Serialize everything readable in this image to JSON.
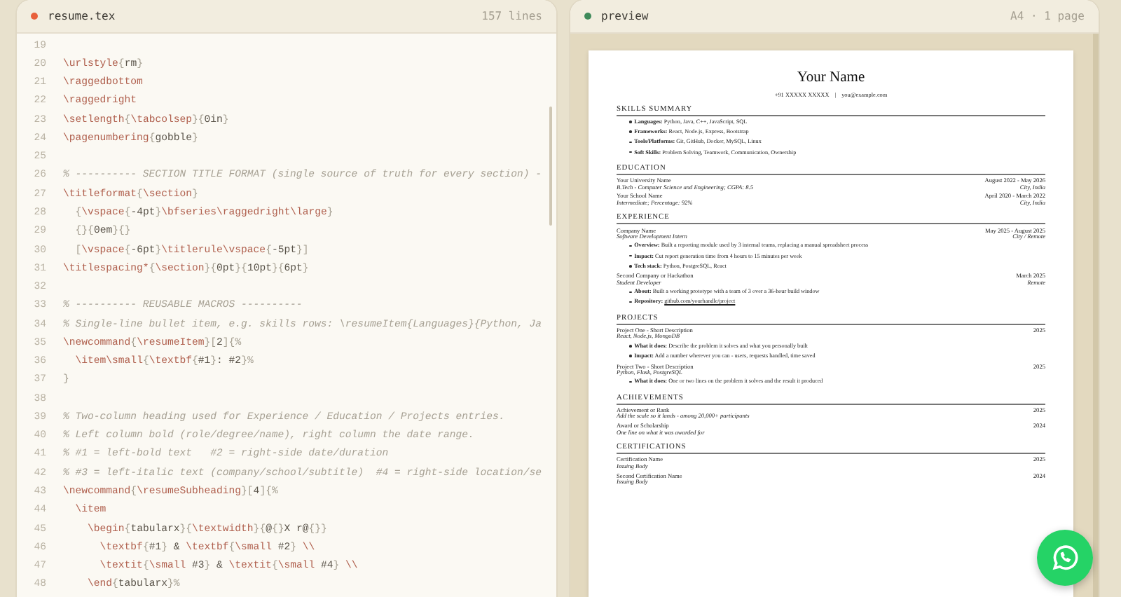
{
  "editor": {
    "filename": "resume.tex",
    "line_count": "157 lines",
    "lines": [
      {
        "n": "19"
      },
      {
        "n": "20",
        "code": "\\urlstyle{rm}"
      },
      {
        "n": "21",
        "code": "\\raggedbottom"
      },
      {
        "n": "22",
        "code": "\\raggedright"
      },
      {
        "n": "23",
        "code": "\\setlength{\\tabcolsep}{0in}"
      },
      {
        "n": "24",
        "code": "\\pagenumbering{gobble}"
      },
      {
        "n": "25"
      },
      {
        "n": "26",
        "code": "% ---------- SECTION TITLE FORMAT (single source of truth for every section) -"
      },
      {
        "n": "27",
        "code": "\\titleformat{\\section}"
      },
      {
        "n": "28",
        "code": "  {\\vspace{-4pt}\\bfseries\\raggedright\\large}"
      },
      {
        "n": "29",
        "code": "  {}{0em}{}"
      },
      {
        "n": "30",
        "code": "  [\\vspace{-6pt}\\titlerule\\vspace{-5pt}]"
      },
      {
        "n": "31",
        "code": "\\titlespacing*{\\section}{0pt}{10pt}{6pt}"
      },
      {
        "n": "32"
      },
      {
        "n": "33",
        "code": "% ---------- REUSABLE MACROS ----------"
      },
      {
        "n": "34",
        "code": "% Single-line bullet item, e.g. skills rows: \\resumeItem{Languages}{Python, Ja"
      },
      {
        "n": "35",
        "code": "\\newcommand{\\resumeItem}[2]{%"
      },
      {
        "n": "36",
        "code": "  \\item\\small{\\textbf{#1}: #2}%"
      },
      {
        "n": "37",
        "code": "}"
      },
      {
        "n": "38"
      },
      {
        "n": "39",
        "code": "% Two-column heading used for Experience / Education / Projects entries."
      },
      {
        "n": "40",
        "code": "% Left column bold (role/degree/name), right column the date range."
      },
      {
        "n": "41",
        "code": "% #1 = left-bold text   #2 = right-side date/duration"
      },
      {
        "n": "42",
        "code": "% #3 = left-italic text (company/school/subtitle)  #4 = right-side location/se"
      },
      {
        "n": "43",
        "code": "\\newcommand{\\resumeSubheading}[4]{%"
      },
      {
        "n": "44",
        "code": "  \\item"
      },
      {
        "n": "45",
        "code": "    \\begin{tabularx}{\\textwidth}{@{}X r@{}}"
      },
      {
        "n": "46",
        "code": "      \\textbf{#1} & \\textbf{\\small #2} \\\\"
      },
      {
        "n": "47",
        "code": "      \\textit{\\small #3} & \\textit{\\small #4} \\\\"
      },
      {
        "n": "48",
        "code": "    \\end{tabularx}%"
      }
    ]
  },
  "preview": {
    "title": "preview",
    "meta": "A4 · 1 page",
    "paper": {
      "name": "Your Name",
      "contact": [
        "+91 XXXXX XXXXX",
        "|",
        "you@example.com"
      ],
      "sections": [
        {
          "title": "SKILLS SUMMARY",
          "items": [
            {
              "kind": "bullet",
              "label": "Languages:",
              "text": "Python, Java, C++, JavaScript, SQL"
            },
            {
              "kind": "bullet",
              "label": "Frameworks:",
              "text": "React, Node.js, Express, Bootstrap"
            },
            {
              "kind": "bullet",
              "label": "Tools/Platforms:",
              "text": "Git, GitHub, Docker, MySQL, Linux"
            },
            {
              "kind": "bullet",
              "label": "Soft Skills:",
              "text": "Problem Solving, Teamwork, Communication, Ownership"
            }
          ]
        },
        {
          "title": "EDUCATION",
          "items": [
            {
              "kind": "entry",
              "title": "Your University Name",
              "date": "August 2022 - May 2026",
              "subtitle": "B.Tech - Computer Science and Engineering; CGPA: 8.5",
              "place": "City, India"
            },
            {
              "kind": "entry",
              "title": "Your School Name",
              "date": "April 2020 - March 2022",
              "subtitle": "Intermediate; Percentage: 92%",
              "place": "City, India"
            }
          ]
        },
        {
          "title": "EXPERIENCE",
          "items": [
            {
              "kind": "entry",
              "title": "Company Name",
              "date": "May 2025 - August 2025",
              "subtitle": "Software Development Intern",
              "place": "City / Remote"
            },
            {
              "kind": "bullet",
              "label": "Overview:",
              "text": "Built a reporting module used by 3 internal teams, replacing a manual spreadsheet process"
            },
            {
              "kind": "bullet",
              "label": "Impact:",
              "text": "Cut report generation time from 4 hours to 15 minutes per week"
            },
            {
              "kind": "bullet",
              "label": "Tech stack:",
              "text": "Python, PostgreSQL, React"
            },
            {
              "kind": "entry",
              "title": "Second Company or Hackathon",
              "date": "March 2025",
              "subtitle": "Student Developer",
              "place": "Remote"
            },
            {
              "kind": "bullet",
              "label": "About:",
              "text": "Built a working prototype with a team of 3 over a 36-hour build window"
            },
            {
              "kind": "link",
              "label": "Repository:",
              "text": "github.com/yourhandle/project"
            }
          ]
        },
        {
          "title": "PROJECTS",
          "items": [
            {
              "kind": "entry",
              "title": "Project One - Short Description",
              "date": "2025",
              "subtitle": "React, Node.js, MongoDB"
            },
            {
              "kind": "bullet",
              "label": "What it does:",
              "text": "Describe the problem it solves and what you personally built"
            },
            {
              "kind": "bullet",
              "label": "Impact:",
              "text": "Add a number wherever you can - users, requests handled, time saved"
            },
            {
              "kind": "entry",
              "title": "Project Two - Short Description",
              "date": "2025",
              "subtitle": "Python, Flask, PostgreSQL"
            },
            {
              "kind": "bullet",
              "label": "What it does:",
              "text": "One or two lines on the problem it solves and the result it produced"
            }
          ]
        },
        {
          "title": "ACHIEVEMENTS",
          "items": [
            {
              "kind": "entry",
              "title": "Achievement or Rank",
              "date": "2025",
              "subtitle": "Add the scale so it lands - among 20,000+ participants"
            },
            {
              "kind": "entry",
              "title": "Award or Scholarship",
              "date": "2024",
              "subtitle": "One line on what it was awarded for"
            }
          ]
        },
        {
          "title": "CERTIFICATIONS",
          "items": [
            {
              "kind": "entry",
              "title": "Certification Name",
              "date": "2025",
              "subtitle": "Issuing Body"
            },
            {
              "kind": "entry",
              "title": "Second Certification Name",
              "date": "2024",
              "subtitle": "Issuing Body"
            }
          ]
        }
      ]
    }
  }
}
